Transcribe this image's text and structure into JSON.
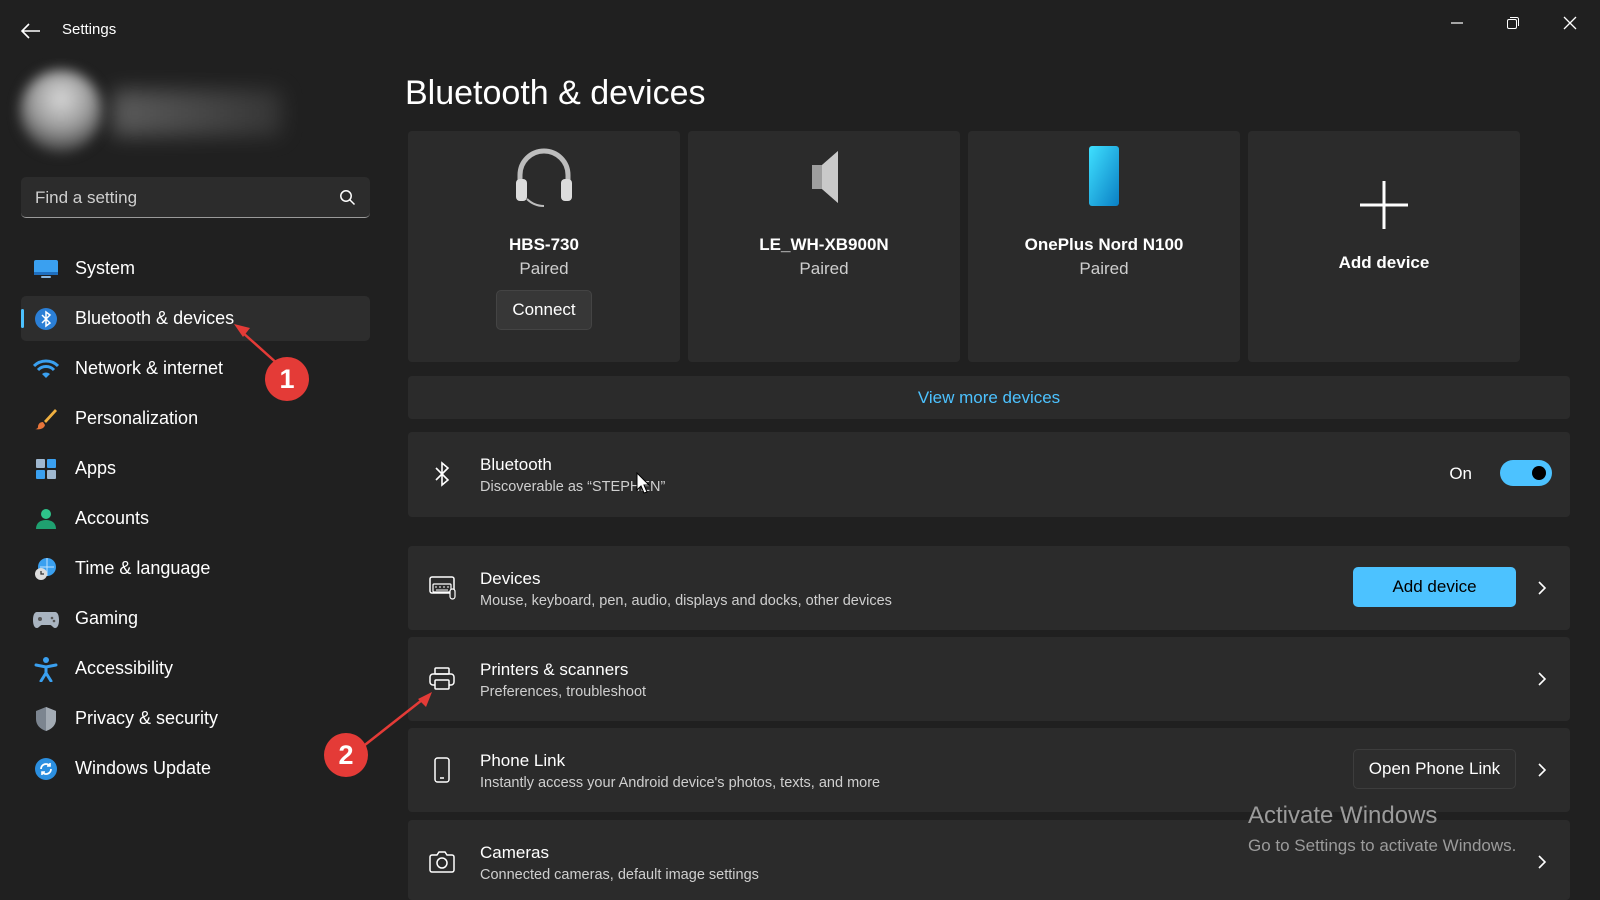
{
  "window": {
    "title": "Settings",
    "controls": [
      "minimize-icon",
      "restore-icon",
      "close-icon"
    ]
  },
  "search": {
    "placeholder": "Find a setting"
  },
  "sidebar": {
    "items": [
      {
        "label": "System",
        "icon": "system-icon"
      },
      {
        "label": "Bluetooth & devices",
        "icon": "bluetooth-icon",
        "active": true
      },
      {
        "label": "Network & internet",
        "icon": "wifi-icon"
      },
      {
        "label": "Personalization",
        "icon": "paintbrush-icon"
      },
      {
        "label": "Apps",
        "icon": "apps-icon"
      },
      {
        "label": "Accounts",
        "icon": "accounts-icon"
      },
      {
        "label": "Time & language",
        "icon": "time-language-icon"
      },
      {
        "label": "Gaming",
        "icon": "gamepad-icon"
      },
      {
        "label": "Accessibility",
        "icon": "accessibility-icon"
      },
      {
        "label": "Privacy & security",
        "icon": "shield-icon"
      },
      {
        "label": "Windows Update",
        "icon": "update-icon"
      }
    ]
  },
  "main": {
    "title": "Bluetooth & devices",
    "devices": [
      {
        "name": "HBS-730",
        "status": "Paired",
        "icon": "headset-icon",
        "button": "Connect"
      },
      {
        "name": "LE_WH-XB900N",
        "status": "Paired",
        "icon": "speaker-icon"
      },
      {
        "name": "OnePlus Nord N100",
        "status": "Paired",
        "icon": "phone-icon"
      }
    ],
    "add_device_card": "Add device",
    "view_more": "View more devices",
    "bluetooth": {
      "title": "Bluetooth",
      "subtitle": "Discoverable as “STEPHEN”",
      "state_label": "On",
      "enabled": true
    },
    "rows": [
      {
        "title": "Devices",
        "subtitle": "Mouse, keyboard, pen, audio, displays and docks, other devices",
        "button": "Add device",
        "icon": "devices-icon"
      },
      {
        "title": "Printers & scanners",
        "subtitle": "Preferences, troubleshoot",
        "icon": "printer-icon"
      },
      {
        "title": "Phone Link",
        "subtitle": "Instantly access your Android device's photos, texts, and more",
        "button": "Open Phone Link",
        "icon": "phone-link-icon"
      },
      {
        "title": "Cameras",
        "subtitle": "Connected cameras, default image settings",
        "icon": "camera-icon"
      }
    ]
  },
  "watermark": {
    "title": "Activate Windows",
    "subtitle": "Go to Settings to activate Windows."
  },
  "annotations": [
    "1",
    "2"
  ],
  "colors": {
    "background": "#202020",
    "card": "#2b2b2b",
    "accent": "#4cc2ff",
    "annotation": "#e43b37"
  }
}
